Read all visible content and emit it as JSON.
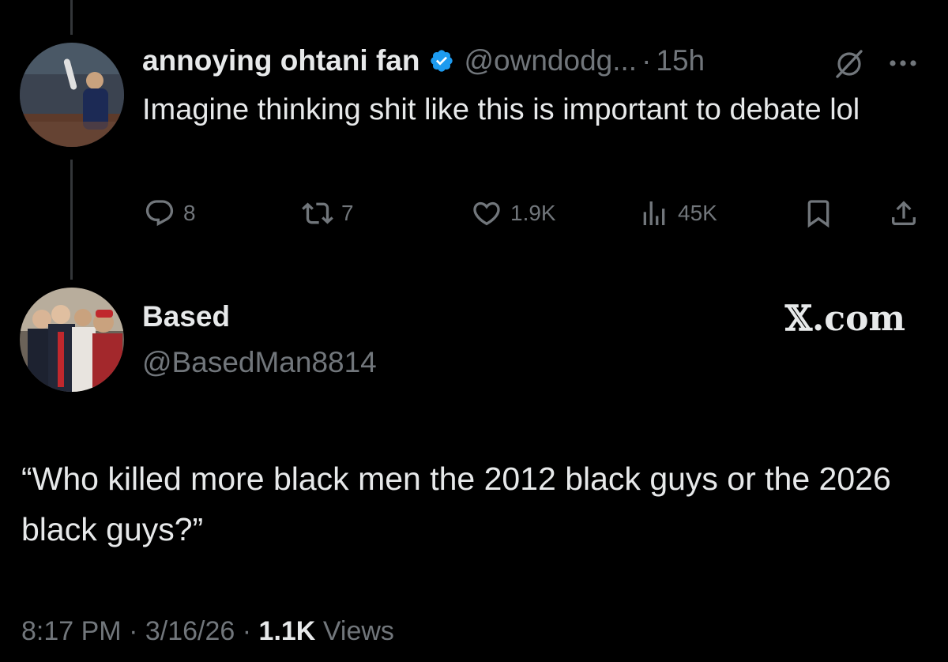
{
  "reply": {
    "display_name": "annoying ohtani fan",
    "handle": "@owndodg...",
    "separator": "·",
    "time": "15h",
    "text": "Imagine thinking shit like this is important to debate lol",
    "verified_color": "#1d9bf0",
    "actions": {
      "replies": "8",
      "retweets": "7",
      "likes": "1.9K",
      "views": "45K"
    },
    "icons": [
      "grok-icon",
      "more-icon",
      "reply-icon",
      "retweet-icon",
      "like-icon",
      "views-icon",
      "bookmark-icon",
      "share-icon"
    ]
  },
  "quoted": {
    "display_name": "Based",
    "handle": "@BasedMan8814",
    "watermark": "𝕏.com",
    "text": "“Who killed more black men the 2012 black guys or the 2026 black guys?”"
  },
  "footer": {
    "time": "8:17 PM",
    "separator": "·",
    "date": "3/16/26",
    "views_count": "1.1K",
    "views_label": "Views"
  },
  "colors": {
    "background": "#000000",
    "text": "#e7e9ea",
    "muted": "#71767b",
    "thread_line": "#333639",
    "accent": "#1d9bf0"
  }
}
